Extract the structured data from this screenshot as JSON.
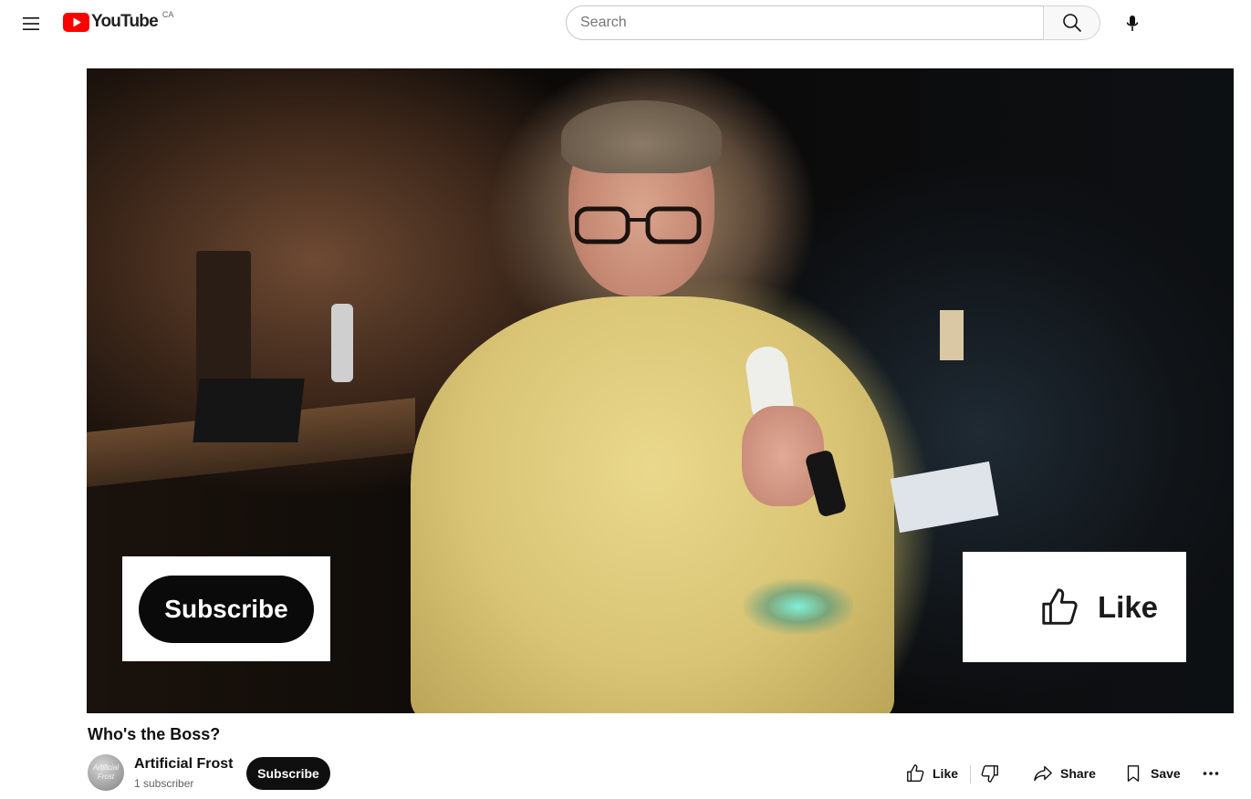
{
  "header": {
    "logo_text": "YouTube",
    "region": "CA",
    "search_placeholder": "Search",
    "icons": [
      "menu-icon",
      "search-icon",
      "mic-icon"
    ],
    "brand_red": "#ff0000"
  },
  "player": {
    "overlay_subscribe_label": "Subscribe",
    "overlay_like_label": "Like"
  },
  "video": {
    "title": "Who's the Boss?"
  },
  "channel": {
    "name": "Artificial Frost",
    "avatar_text": "Artificial Frost",
    "subscribers": "1 subscriber",
    "subscribe_label": "Subscribe"
  },
  "actions": {
    "like_label": "Like",
    "share_label": "Share",
    "save_label": "Save",
    "icons": [
      "thumbs-up-icon",
      "thumbs-down-icon",
      "share-icon",
      "bookmark-icon",
      "more-icon"
    ]
  }
}
